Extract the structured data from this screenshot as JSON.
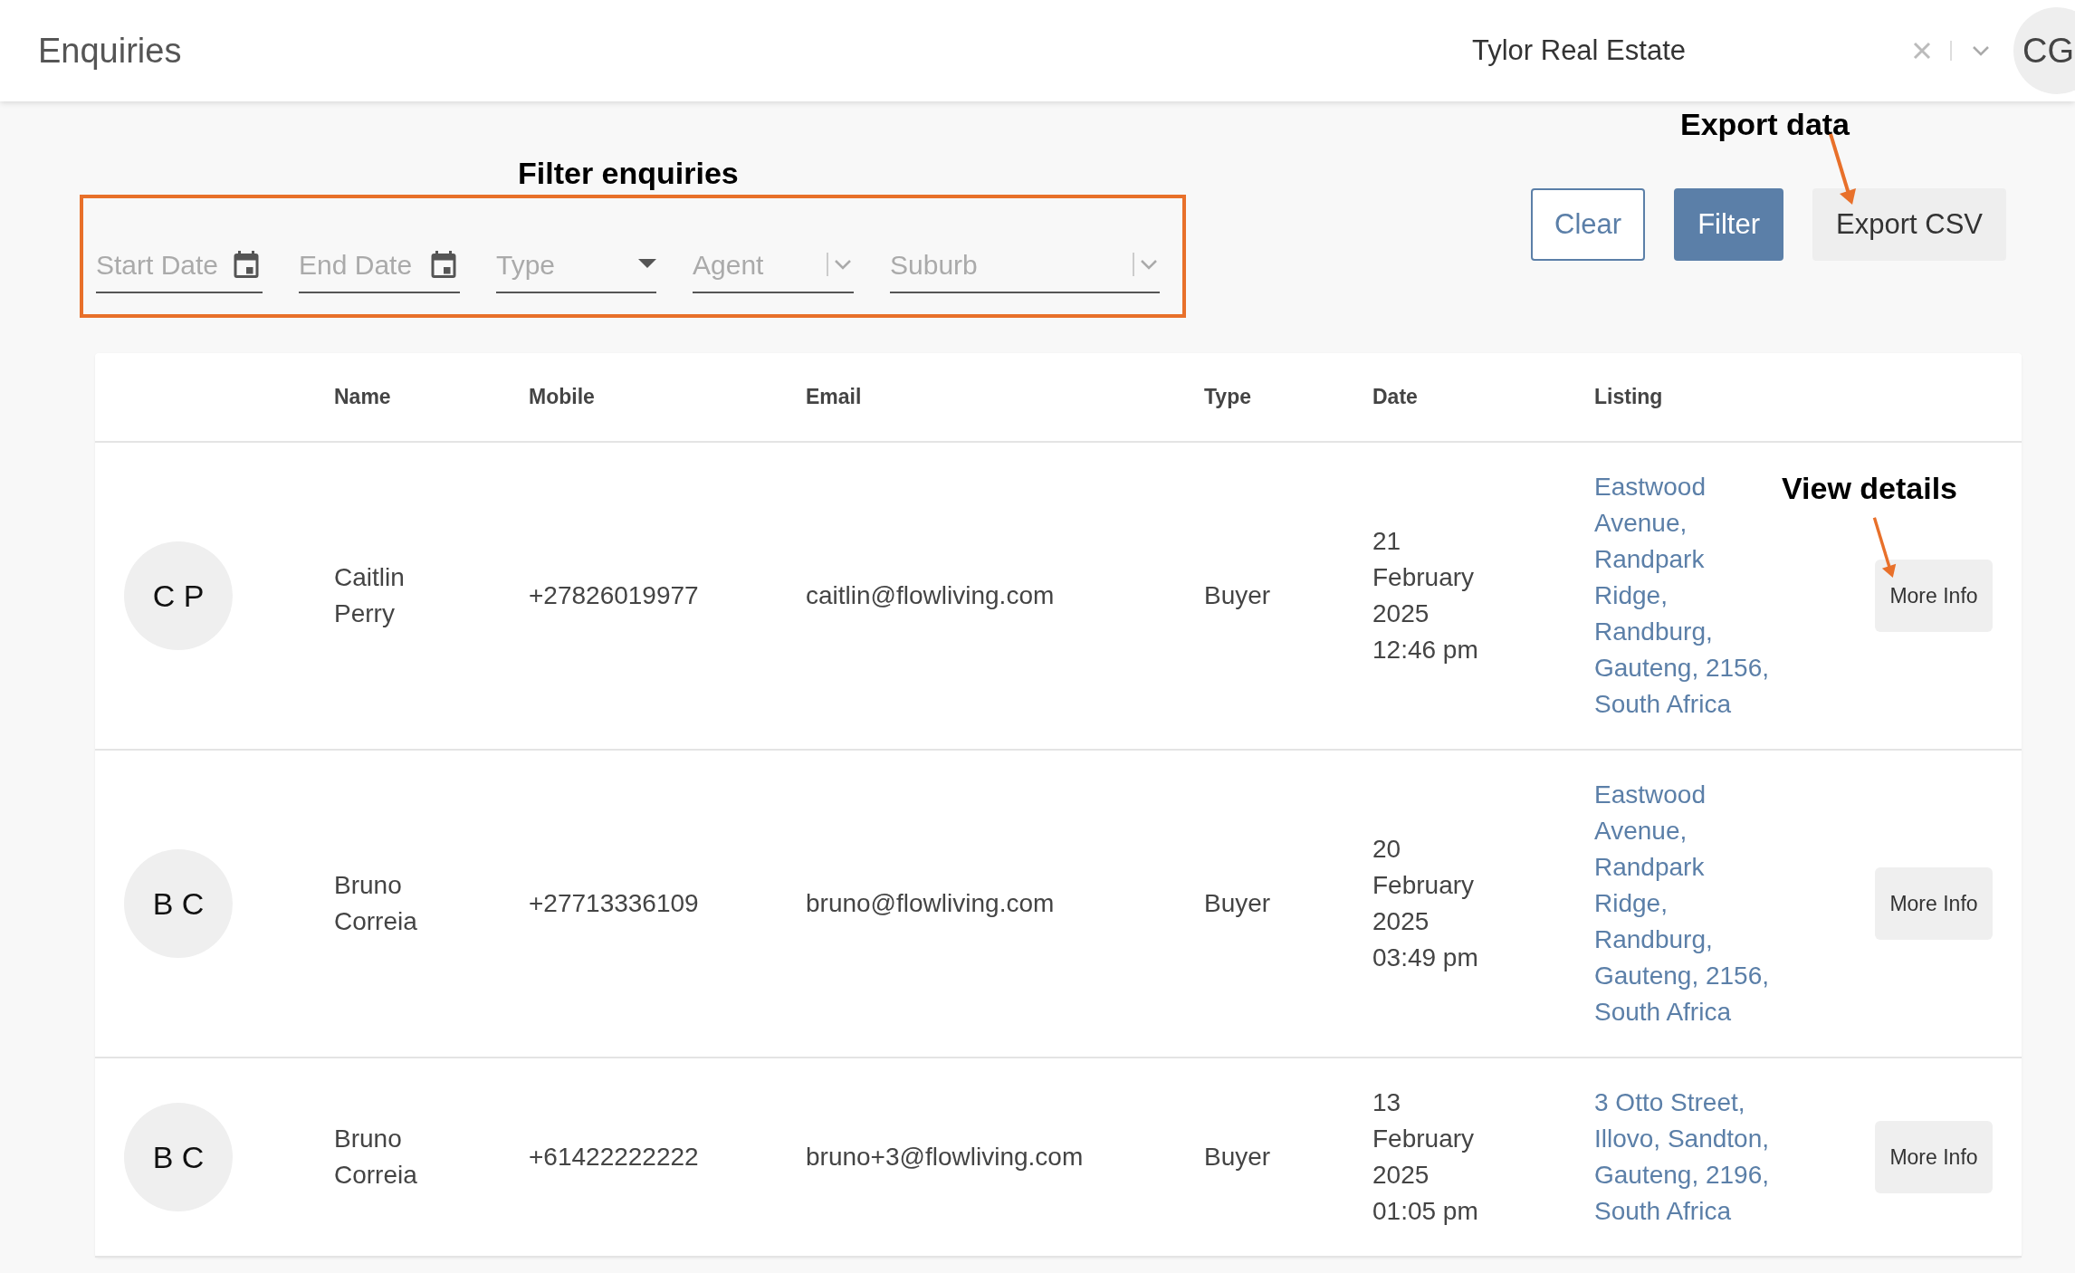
{
  "header": {
    "title": "Enquiries",
    "agency": "Tylor Real Estate",
    "user_initials": "CG"
  },
  "filters": [
    {
      "kind": "date",
      "placeholder": "Start Date"
    },
    {
      "kind": "date",
      "placeholder": "End Date"
    },
    {
      "kind": "select",
      "placeholder": "Type"
    },
    {
      "kind": "combo",
      "placeholder": "Agent"
    },
    {
      "kind": "combo",
      "placeholder": "Suburb"
    }
  ],
  "buttons": [
    {
      "label": "Clear",
      "kind": "outline"
    },
    {
      "label": "Filter",
      "kind": "primary"
    },
    {
      "label": "Export CSV",
      "kind": "plain"
    }
  ],
  "table": {
    "columns": [
      "Name",
      "Mobile",
      "Email",
      "Type",
      "Date",
      "Listing"
    ],
    "rows": [
      {
        "initials": "C P",
        "name": "Caitlin Perry",
        "mobile": "+27826019977",
        "email": "caitlin@flowliving.com",
        "type": "Buyer",
        "date": "21 February 2025 12:46 pm",
        "listing": "Eastwood Avenue, Randpark Ridge, Randburg, Gauteng, 2156, South Africa",
        "action": "More Info"
      },
      {
        "initials": "B C",
        "name": "Bruno Correia",
        "mobile": "+27713336109",
        "email": "bruno@flowliving.com",
        "type": "Buyer",
        "date": "20 February 2025 03:49 pm",
        "listing": "Eastwood Avenue, Randpark Ridge, Randburg, Gauteng, 2156, South Africa",
        "action": "More Info"
      },
      {
        "initials": "B C",
        "name": "Bruno Correia",
        "mobile": "+61422222222",
        "email": "bruno+3@flowliving.com",
        "type": "Buyer",
        "date": "13 February 2025 01:05 pm",
        "listing": "3 Otto Street, Illovo, Sandton, Gauteng, 2196, South Africa",
        "action": "More Info"
      }
    ]
  },
  "annotations": [
    {
      "text": "Filter enquiries"
    },
    {
      "text": "Export data"
    },
    {
      "text": "View details"
    }
  ]
}
